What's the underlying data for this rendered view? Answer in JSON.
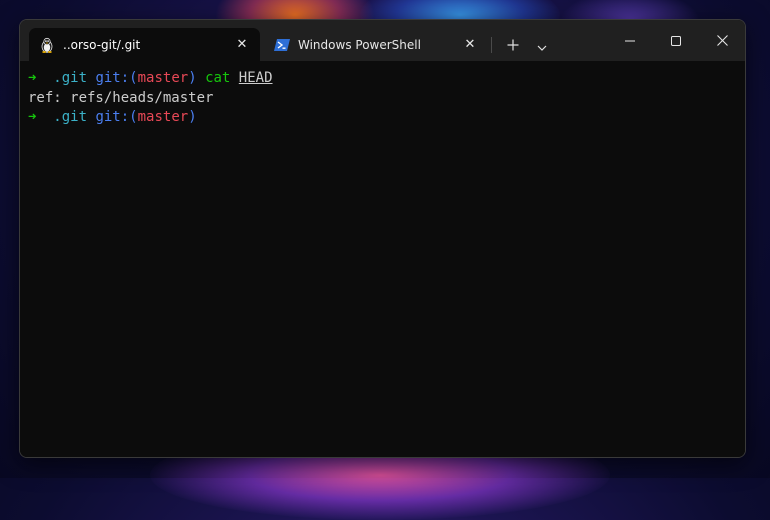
{
  "colors": {
    "window_bg": "#0c0c0c",
    "titlebar_bg": "#202020",
    "prompt_arrow": "#16c60c",
    "dir": "#3bb1c8",
    "git_word": "#4b7ff1",
    "branch": "#e74856",
    "command": "#16c60c",
    "text": "#cccccc"
  },
  "tabs": [
    {
      "label": "..orso-git/.git",
      "icon": "linux-penguin-icon",
      "active": true
    },
    {
      "label": "Windows PowerShell",
      "icon": "powershell-icon",
      "active": false
    }
  ],
  "titlebar": {
    "new_tab": "+",
    "dropdown": "⌄",
    "minimize": "─",
    "maximize": "☐",
    "close": "✕",
    "tab_close": "✕"
  },
  "terminal": {
    "prompt1": {
      "arrow": "➜",
      "dir": ".git",
      "git": "git:",
      "open_paren": "(",
      "branch": "master",
      "close_paren": ")",
      "command": "cat",
      "argument": "HEAD"
    },
    "output": "ref: refs/heads/master",
    "prompt2": {
      "arrow": "➜",
      "dir": ".git",
      "git": "git:",
      "open_paren": "(",
      "branch": "master",
      "close_paren": ")"
    }
  }
}
